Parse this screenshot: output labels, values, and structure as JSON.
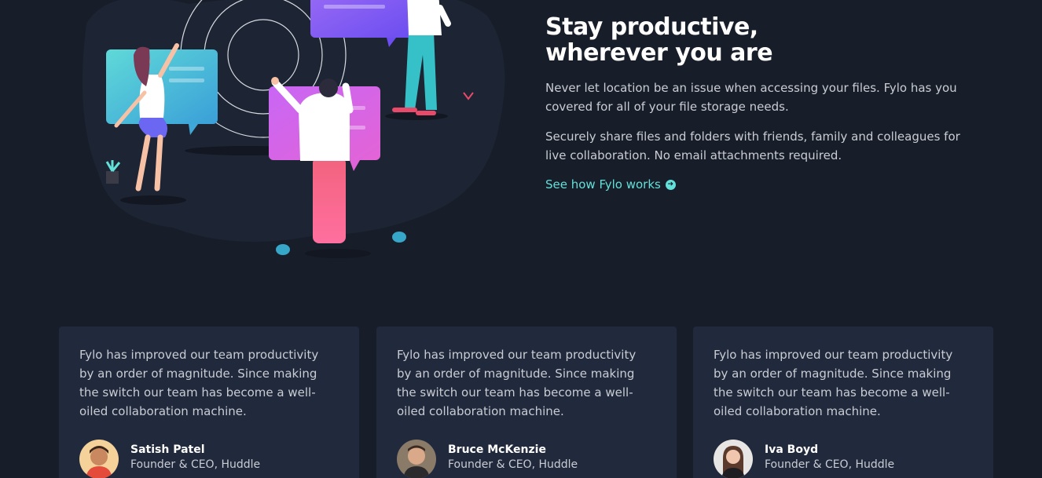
{
  "productive": {
    "headline_line1": "Stay productive,",
    "headline_line2": "wherever you are",
    "paragraph1": "Never let location be an issue when accessing your files. Fylo has you covered for all of your file storage needs.",
    "paragraph2": "Securely share files and folders with friends, family and colleagues for live collaboration. No email attachments required.",
    "link_label": "See how Fylo works",
    "link_icon": "arrow-circle-icon",
    "accent_color": "#62e0d9"
  },
  "testimonials": [
    {
      "quote": "Fylo has improved our team productivity by an order of magnitude. Since making the switch our team has become a well-oiled collaboration machine.",
      "name": "Satish Patel",
      "role": "Founder & CEO, Huddle"
    },
    {
      "quote": "Fylo has improved our team productivity by an order of magnitude. Since making the switch our team has become a well-oiled collaboration machine.",
      "name": "Bruce McKenzie",
      "role": "Founder & CEO, Huddle"
    },
    {
      "quote": "Fylo has improved our team productivity by an order of magnitude. Since making the switch our team has become a well-oiled collaboration machine.",
      "name": "Iva Boyd",
      "role": "Founder & CEO, Huddle"
    }
  ],
  "colors": {
    "background": "#181e29",
    "card": "#212a3c",
    "text_muted": "#c9ccd3"
  }
}
